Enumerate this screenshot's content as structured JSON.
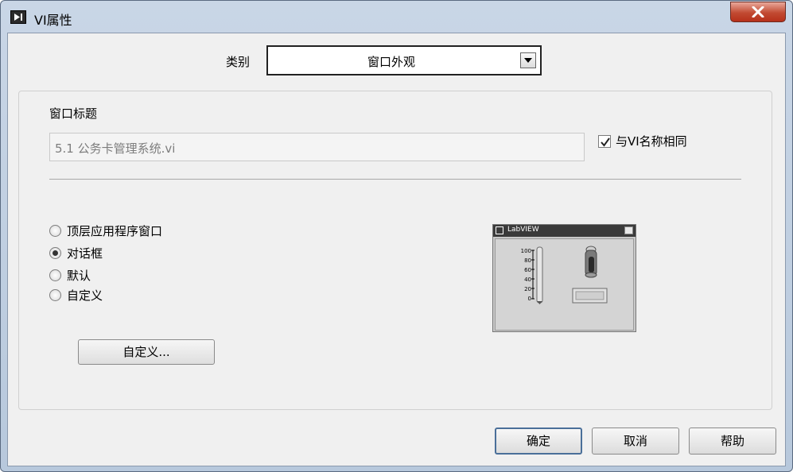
{
  "window": {
    "title": "VI属性",
    "icon": "labview-vi-icon"
  },
  "category": {
    "label": "类别",
    "selected": "窗口外观"
  },
  "window_title_section": {
    "label": "窗口标题",
    "value": "5.1  公务卡管理系统.vi",
    "same_as_vi_name_label": "与VI名称相同",
    "same_as_vi_name_checked": true
  },
  "appearance_options": [
    {
      "label": "顶层应用程序窗口",
      "selected": false
    },
    {
      "label": "对话框",
      "selected": true
    },
    {
      "label": "默认",
      "selected": false
    },
    {
      "label": "自定义",
      "selected": false
    }
  ],
  "customize_button": "自定义...",
  "preview": {
    "title": "LabVIEW",
    "scale_labels": [
      "100",
      "80",
      "60",
      "40",
      "20",
      "0"
    ]
  },
  "buttons": {
    "ok": "确定",
    "cancel": "取消",
    "help": "帮助"
  }
}
